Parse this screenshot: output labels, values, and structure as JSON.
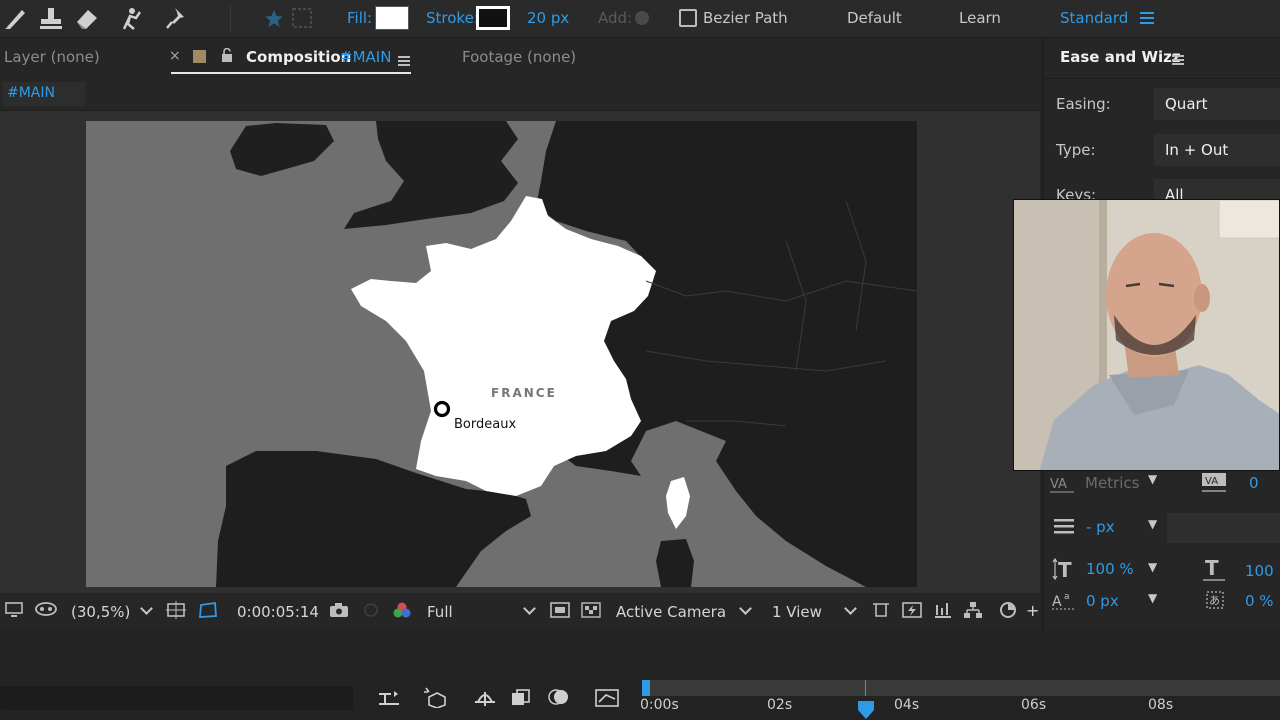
{
  "toolbar": {
    "fill_label": "Fill:",
    "stroke_label": "Stroke:",
    "stroke_width": "20 px",
    "add_label": "Add:",
    "bezier_label": "Bezier Path",
    "workspace_default": "Default",
    "workspace_learn": "Learn",
    "workspace_standard": "Standard"
  },
  "tabs": {
    "layer": "Layer (none)",
    "composition_prefix": "Composition",
    "composition_name": "#MAIN",
    "footage": "Footage (none)"
  },
  "comp_name_field": "#MAIN",
  "map": {
    "country_label": "FRANCE",
    "city_label": "Bordeaux"
  },
  "viewer_footer": {
    "zoom": "(30,5%)",
    "timecode": "0:00:05:14",
    "resolution": "Full",
    "camera": "Active Camera",
    "views": "1 View"
  },
  "right_panel": {
    "title": "Ease and Wizz",
    "easing_label": "Easing:",
    "easing_value": "Quart",
    "type_label": "Type:",
    "type_value": "In + Out",
    "keys_label": "Keys:",
    "keys_value": "All",
    "kerning_mode": "Metrics",
    "tracking_value": "0",
    "leading_value": "- px",
    "vertical_scale": "100 %",
    "horizontal_scale": "100",
    "baseline_shift": "0 px",
    "tsume": "0 %"
  },
  "timeline": {
    "ticks": [
      "0:00s",
      "02s",
      "04s",
      "06s",
      "08s"
    ]
  },
  "colors": {
    "accent": "#2f9be6",
    "land_highlight": "#ffffff",
    "land_dark": "#1e1e1e",
    "sea": "#6f6f6f"
  }
}
